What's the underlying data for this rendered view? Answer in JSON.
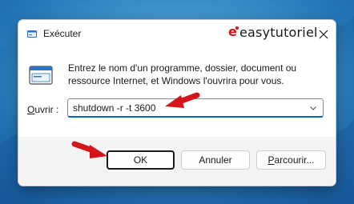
{
  "dialog": {
    "title": "Exécuter",
    "watermark": "easytutoriel",
    "description": "Entrez le nom d'un programme, dossier, document ou ressource Internet, et Windows l'ouvrira pour vous.",
    "open_label": "Ouvrir :",
    "open_label_accesskey": "O",
    "open_label_rest": "uvrir :",
    "command_value": "shutdown -r -t 3600"
  },
  "buttons": {
    "ok": "OK",
    "cancel": "Annuler",
    "browse_accesskey": "P",
    "browse_rest": "arcourir..."
  },
  "icons": {
    "title": "run-icon",
    "app": "run-app-icon",
    "close": "close-icon",
    "dropdown": "chevron-down-icon",
    "arrows": "red-arrow-annotation"
  },
  "colors": {
    "accent": "#0067c0",
    "annotation_arrow": "#d4161b",
    "watermark_logo": "#d4161b"
  }
}
